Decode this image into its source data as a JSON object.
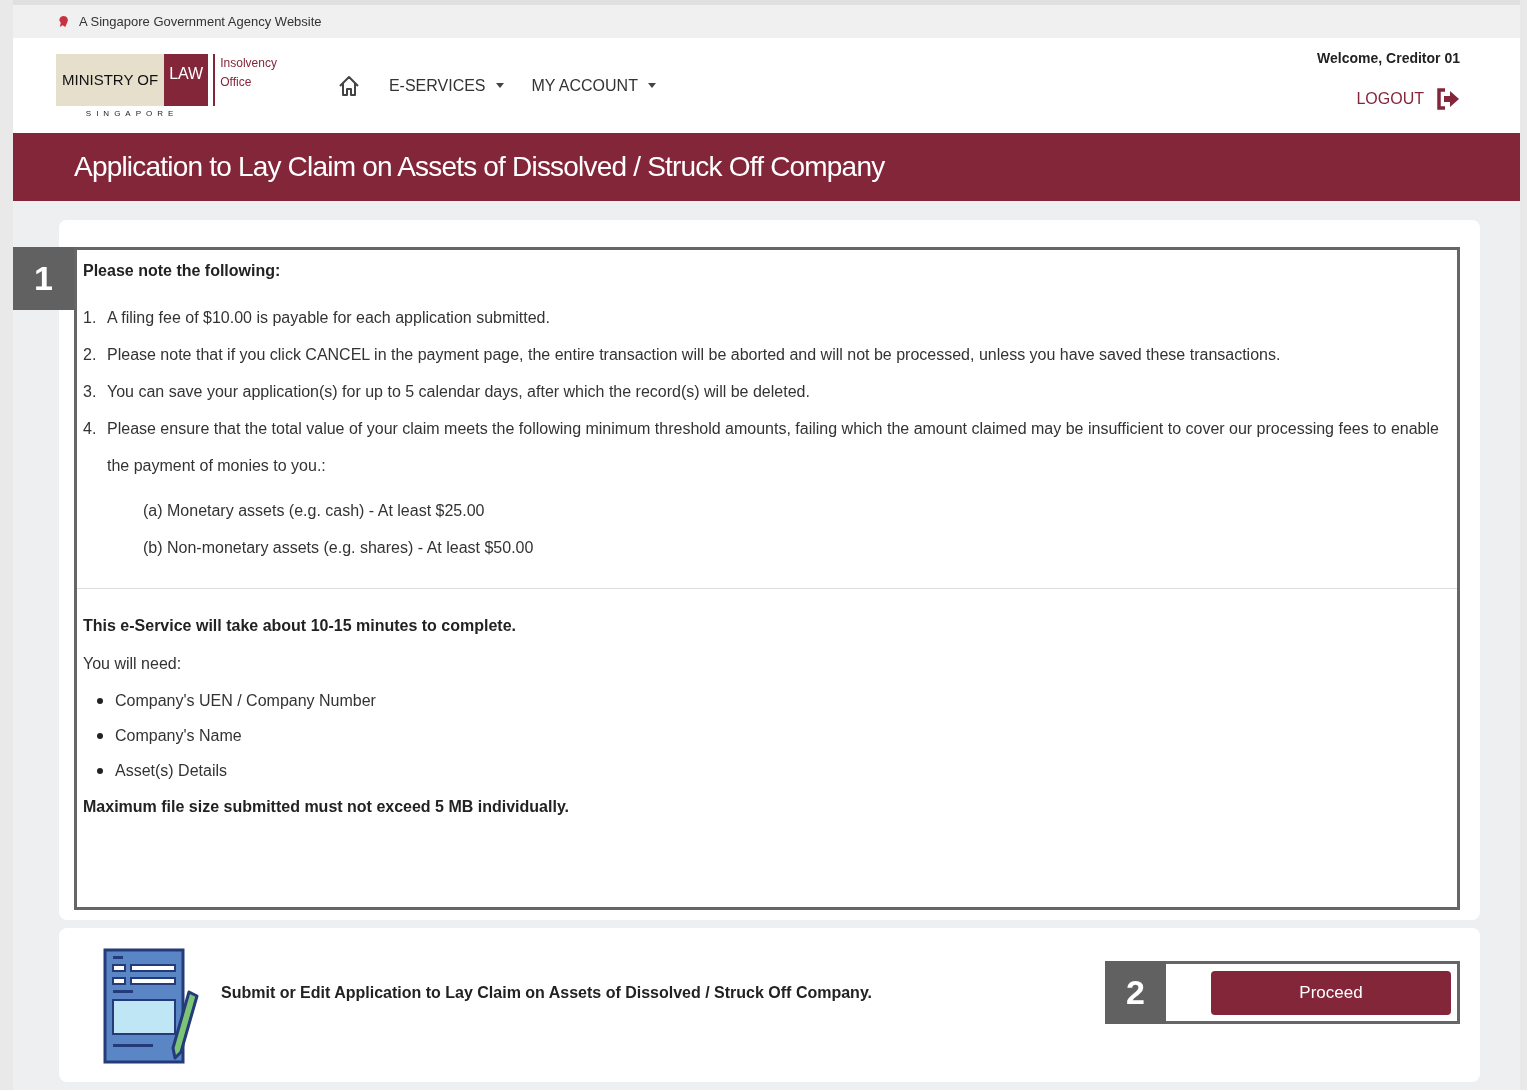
{
  "gov_bar": {
    "text": "A Singapore Government Agency Website"
  },
  "header": {
    "logo": {
      "name": "MINISTRY OF",
      "name_highlight": "LAW",
      "country": "SINGAPORE",
      "office": [
        "Insolvency",
        "Office"
      ]
    },
    "nav": [
      {
        "label": "E-SERVICES",
        "dropdown": true
      },
      {
        "label": "MY ACCOUNT",
        "dropdown": true
      }
    ],
    "welcome": "Welcome, Creditor 01",
    "logout": "LOGOUT"
  },
  "page_title": "Application to Lay Claim on Assets of Dissolved / Struck Off Company",
  "notice": {
    "callout": "1",
    "heading": "Please note the following:",
    "items": [
      {
        "number": "1.",
        "text": "A filing fee of $10.00 is payable for each application submitted."
      },
      {
        "number": "2.",
        "text": "Please note that if you click CANCEL in the payment page, the entire transaction will be aborted and will not be processed, unless you have saved these transactions."
      },
      {
        "number": "3.",
        "text": "You can save your application(s) for up to 5 calendar days, after which the record(s) will be deleted."
      },
      {
        "number": "4.",
        "text": "Please ensure that the total value of your claim meets the following minimum threshold amounts, failing which the amount claimed may be insufficient to cover our processing fees to enable the payment of monies to you.:",
        "sub_items": [
          "(a) Monetary assets (e.g. cash) - At least $25.00",
          "(b) Non-monetary assets (e.g. shares) - At least $50.00"
        ]
      }
    ],
    "duration": "This e-Service will take about 10-15 minutes to complete.",
    "needs_intro": "You will need:",
    "needs": [
      "Company's UEN / Company Number",
      "Company's Name",
      "Asset(s) Details"
    ],
    "file_limit": "Maximum file size submitted must not exceed 5 MB individually."
  },
  "action": {
    "text": "Submit or Edit Application to Lay Claim on Assets of Dissolved / Struck Off Company.",
    "callout": "2",
    "button": "Proceed"
  }
}
